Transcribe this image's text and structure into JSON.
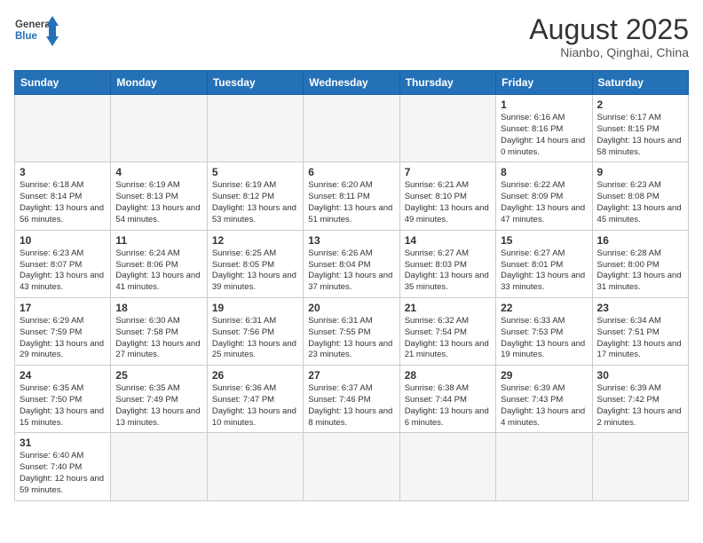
{
  "header": {
    "logo_general": "General",
    "logo_blue": "Blue",
    "main_title": "August 2025",
    "subtitle": "Nianbo, Qinghai, China"
  },
  "days_of_week": [
    "Sunday",
    "Monday",
    "Tuesday",
    "Wednesday",
    "Thursday",
    "Friday",
    "Saturday"
  ],
  "weeks": [
    [
      {
        "day": "",
        "detail": ""
      },
      {
        "day": "",
        "detail": ""
      },
      {
        "day": "",
        "detail": ""
      },
      {
        "day": "",
        "detail": ""
      },
      {
        "day": "",
        "detail": ""
      },
      {
        "day": "1",
        "detail": "Sunrise: 6:16 AM\nSunset: 8:16 PM\nDaylight: 14 hours and 0 minutes."
      },
      {
        "day": "2",
        "detail": "Sunrise: 6:17 AM\nSunset: 8:15 PM\nDaylight: 13 hours and 58 minutes."
      }
    ],
    [
      {
        "day": "3",
        "detail": "Sunrise: 6:18 AM\nSunset: 8:14 PM\nDaylight: 13 hours and 56 minutes."
      },
      {
        "day": "4",
        "detail": "Sunrise: 6:19 AM\nSunset: 8:13 PM\nDaylight: 13 hours and 54 minutes."
      },
      {
        "day": "5",
        "detail": "Sunrise: 6:19 AM\nSunset: 8:12 PM\nDaylight: 13 hours and 53 minutes."
      },
      {
        "day": "6",
        "detail": "Sunrise: 6:20 AM\nSunset: 8:11 PM\nDaylight: 13 hours and 51 minutes."
      },
      {
        "day": "7",
        "detail": "Sunrise: 6:21 AM\nSunset: 8:10 PM\nDaylight: 13 hours and 49 minutes."
      },
      {
        "day": "8",
        "detail": "Sunrise: 6:22 AM\nSunset: 8:09 PM\nDaylight: 13 hours and 47 minutes."
      },
      {
        "day": "9",
        "detail": "Sunrise: 6:23 AM\nSunset: 8:08 PM\nDaylight: 13 hours and 45 minutes."
      }
    ],
    [
      {
        "day": "10",
        "detail": "Sunrise: 6:23 AM\nSunset: 8:07 PM\nDaylight: 13 hours and 43 minutes."
      },
      {
        "day": "11",
        "detail": "Sunrise: 6:24 AM\nSunset: 8:06 PM\nDaylight: 13 hours and 41 minutes."
      },
      {
        "day": "12",
        "detail": "Sunrise: 6:25 AM\nSunset: 8:05 PM\nDaylight: 13 hours and 39 minutes."
      },
      {
        "day": "13",
        "detail": "Sunrise: 6:26 AM\nSunset: 8:04 PM\nDaylight: 13 hours and 37 minutes."
      },
      {
        "day": "14",
        "detail": "Sunrise: 6:27 AM\nSunset: 8:03 PM\nDaylight: 13 hours and 35 minutes."
      },
      {
        "day": "15",
        "detail": "Sunrise: 6:27 AM\nSunset: 8:01 PM\nDaylight: 13 hours and 33 minutes."
      },
      {
        "day": "16",
        "detail": "Sunrise: 6:28 AM\nSunset: 8:00 PM\nDaylight: 13 hours and 31 minutes."
      }
    ],
    [
      {
        "day": "17",
        "detail": "Sunrise: 6:29 AM\nSunset: 7:59 PM\nDaylight: 13 hours and 29 minutes."
      },
      {
        "day": "18",
        "detail": "Sunrise: 6:30 AM\nSunset: 7:58 PM\nDaylight: 13 hours and 27 minutes."
      },
      {
        "day": "19",
        "detail": "Sunrise: 6:31 AM\nSunset: 7:56 PM\nDaylight: 13 hours and 25 minutes."
      },
      {
        "day": "20",
        "detail": "Sunrise: 6:31 AM\nSunset: 7:55 PM\nDaylight: 13 hours and 23 minutes."
      },
      {
        "day": "21",
        "detail": "Sunrise: 6:32 AM\nSunset: 7:54 PM\nDaylight: 13 hours and 21 minutes."
      },
      {
        "day": "22",
        "detail": "Sunrise: 6:33 AM\nSunset: 7:53 PM\nDaylight: 13 hours and 19 minutes."
      },
      {
        "day": "23",
        "detail": "Sunrise: 6:34 AM\nSunset: 7:51 PM\nDaylight: 13 hours and 17 minutes."
      }
    ],
    [
      {
        "day": "24",
        "detail": "Sunrise: 6:35 AM\nSunset: 7:50 PM\nDaylight: 13 hours and 15 minutes."
      },
      {
        "day": "25",
        "detail": "Sunrise: 6:35 AM\nSunset: 7:49 PM\nDaylight: 13 hours and 13 minutes."
      },
      {
        "day": "26",
        "detail": "Sunrise: 6:36 AM\nSunset: 7:47 PM\nDaylight: 13 hours and 10 minutes."
      },
      {
        "day": "27",
        "detail": "Sunrise: 6:37 AM\nSunset: 7:46 PM\nDaylight: 13 hours and 8 minutes."
      },
      {
        "day": "28",
        "detail": "Sunrise: 6:38 AM\nSunset: 7:44 PM\nDaylight: 13 hours and 6 minutes."
      },
      {
        "day": "29",
        "detail": "Sunrise: 6:39 AM\nSunset: 7:43 PM\nDaylight: 13 hours and 4 minutes."
      },
      {
        "day": "30",
        "detail": "Sunrise: 6:39 AM\nSunset: 7:42 PM\nDaylight: 13 hours and 2 minutes."
      }
    ],
    [
      {
        "day": "31",
        "detail": "Sunrise: 6:40 AM\nSunset: 7:40 PM\nDaylight: 12 hours and 59 minutes."
      },
      {
        "day": "",
        "detail": ""
      },
      {
        "day": "",
        "detail": ""
      },
      {
        "day": "",
        "detail": ""
      },
      {
        "day": "",
        "detail": ""
      },
      {
        "day": "",
        "detail": ""
      },
      {
        "day": "",
        "detail": ""
      }
    ]
  ]
}
